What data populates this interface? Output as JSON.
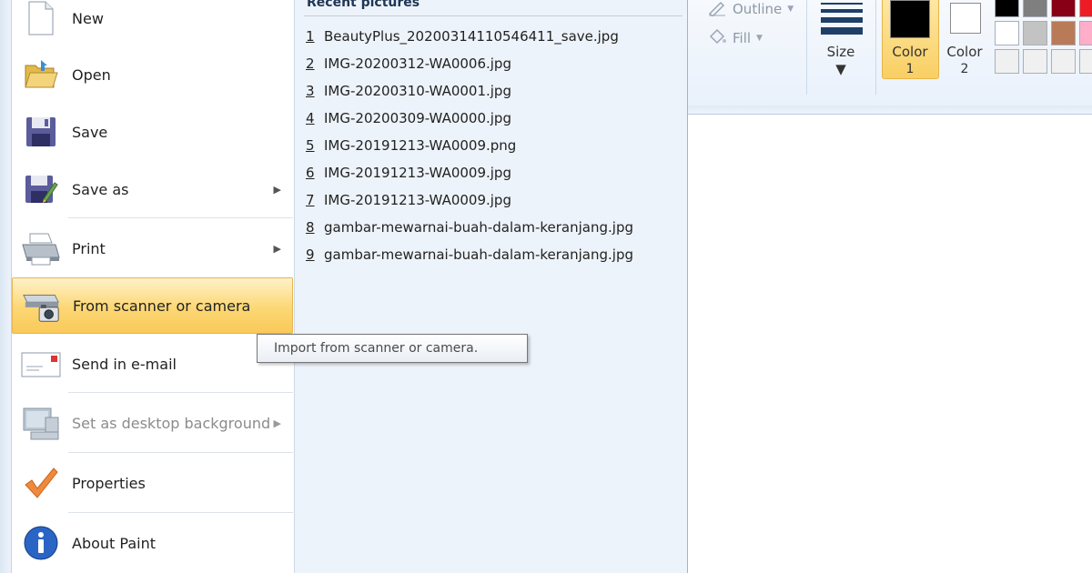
{
  "ribbon": {
    "outline_label": "Outline",
    "fill_label": "Fill",
    "size_label": "Size",
    "color1_label": "Color",
    "color1_num": "1",
    "color2_label": "Color",
    "color2_num": "2",
    "color1_value": "#000000",
    "color2_value": "#ffffff",
    "palette": [
      "#000000",
      "#7f7f7f",
      "#880015",
      "#ed1c24",
      "#ffffff",
      "#c3c3c3",
      "#b97a57",
      "#ffaec9",
      "#f0f0f0",
      "#f0f0f0",
      "#f0f0f0",
      "#f0f0f0"
    ]
  },
  "menu": {
    "items": [
      {
        "label": "New",
        "icon": "new-file-icon"
      },
      {
        "label": "Open",
        "icon": "open-folder-icon"
      },
      {
        "label": "Save",
        "icon": "save-disk-icon"
      },
      {
        "label": "Save as",
        "icon": "save-as-icon"
      },
      {
        "label": "Print",
        "icon": "printer-icon"
      },
      {
        "label": "From scanner or camera",
        "icon": "scanner-camera-icon"
      },
      {
        "label": "Send in e-mail",
        "icon": "email-icon"
      },
      {
        "label": "Set as desktop background",
        "icon": "desktop-icon"
      },
      {
        "label": "Properties",
        "icon": "checkmark-icon"
      },
      {
        "label": "About Paint",
        "icon": "info-icon"
      }
    ]
  },
  "recent": {
    "title": "Recent pictures",
    "items": [
      {
        "num": "1",
        "name": "BeautyPlus_20200314110546411_save.jpg"
      },
      {
        "num": "2",
        "name": "IMG-20200312-WA0006.jpg"
      },
      {
        "num": "3",
        "name": "IMG-20200310-WA0001.jpg"
      },
      {
        "num": "4",
        "name": "IMG-20200309-WA0000.jpg"
      },
      {
        "num": "5",
        "name": "IMG-20191213-WA0009.png"
      },
      {
        "num": "6",
        "name": "IMG-20191213-WA0009.jpg"
      },
      {
        "num": "7",
        "name": "IMG-20191213-WA0009.jpg"
      },
      {
        "num": "8",
        "name": "gambar-mewarnai-buah-dalam-keranjang.jpg"
      },
      {
        "num": "9",
        "name": "gambar-mewarnai-buah-dalam-keranjang.jpg"
      }
    ]
  },
  "tooltip": {
    "text": "Import from scanner or camera."
  }
}
